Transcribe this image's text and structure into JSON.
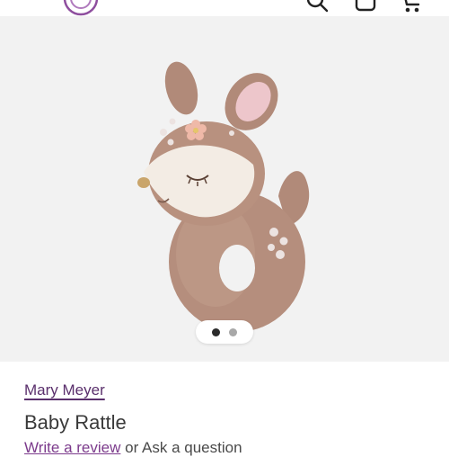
{
  "header": {
    "logo_icon": "brand-logo-circle",
    "search_icon": "search-icon",
    "account_icon": "account-icon",
    "cart_icon": "cart-icon"
  },
  "gallery": {
    "image_subject": "plush fawn ring rattle",
    "pager": {
      "count": 2,
      "active_index": 0
    }
  },
  "product": {
    "brand": "Mary Meyer",
    "title": "Baby Rattle",
    "review_link": "Write a review",
    "review_separator": " or ",
    "ask_link": "Ask a question"
  },
  "colors": {
    "brand_link": "#5a2f6c",
    "review_link": "#7c3b8c",
    "gallery_bg": "#f2f2f2",
    "dot_active": "#2b2b2b",
    "dot_inactive": "#a8a8a8"
  }
}
